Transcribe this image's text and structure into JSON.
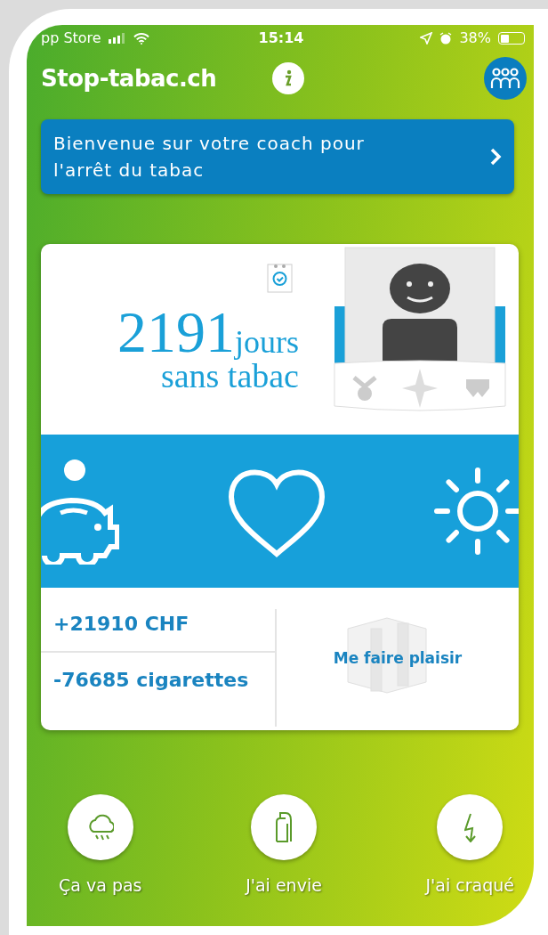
{
  "status_bar": {
    "carrier": "pp Store",
    "time": "15:14",
    "battery": "38%",
    "battery_charge": {
      "level": 0.38
    }
  },
  "header": {
    "title": "Stop-tabac.ch"
  },
  "welcome": {
    "text": "Bienvenue sur votre coach pour l'arrêt du tabac"
  },
  "counter": {
    "number": "2191",
    "unit": "jours",
    "caption": "sans tabac"
  },
  "stats": [
    {
      "text": "+21910 CHF"
    },
    {
      "text": "-76685 cigarettes"
    }
  ],
  "reward": {
    "label": "Me faire plaisir"
  },
  "actions": [
    {
      "kind": "rain",
      "label": "Ça va pas"
    },
    {
      "kind": "inhaler",
      "label": "J'ai envie"
    },
    {
      "kind": "lightning",
      "label": "J'ai craqué"
    }
  ]
}
